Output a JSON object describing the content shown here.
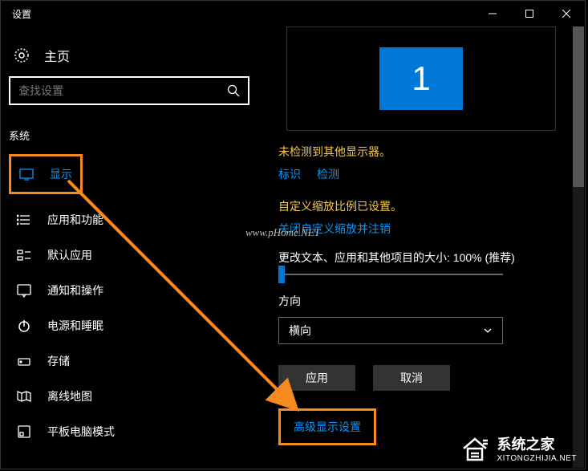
{
  "title": "设置",
  "home": "主页",
  "search": {
    "placeholder": "查找设置"
  },
  "section": "系统",
  "nav": [
    {
      "label": "显示"
    },
    {
      "label": "应用和功能"
    },
    {
      "label": "默认应用"
    },
    {
      "label": "通知和操作"
    },
    {
      "label": "电源和睡眠"
    },
    {
      "label": "存储"
    },
    {
      "label": "离线地图"
    },
    {
      "label": "平板电脑模式"
    }
  ],
  "monitor": {
    "num": "1"
  },
  "detect": {
    "message": "未检测到其他显示器。",
    "identify": "标识",
    "detect": "检测"
  },
  "scale": {
    "custom": "自定义缩放比例已设置。",
    "signout": "关闭自定义缩放并注销",
    "resize": "更改文本、应用和其他项目的大小: 100% (推荐)"
  },
  "orientation": {
    "label": "方向",
    "value": "横向"
  },
  "buttons": {
    "apply": "应用",
    "cancel": "取消"
  },
  "advanced": "高级显示设置",
  "wm1": "www.pHome.NET",
  "wm2": {
    "cn": "系统之家",
    "en": "XITONGZHIJIA.NET"
  }
}
